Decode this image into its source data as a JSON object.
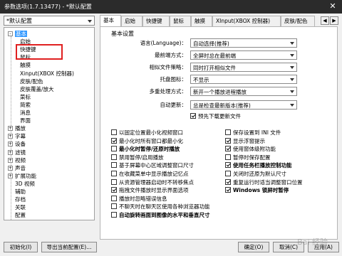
{
  "window": {
    "title": "参数选项(1.7.13477) - *默认配置",
    "close_glyph": "✕"
  },
  "profile": {
    "selected": "*默认配置"
  },
  "tree": {
    "items": [
      {
        "label": "基本",
        "expander": "-",
        "selected": true
      },
      {
        "label": "启始"
      },
      {
        "label": "快捷键"
      },
      {
        "label": "鼠标"
      },
      {
        "label": "触摸"
      },
      {
        "label": "Xinput(XBOX 控制器)"
      },
      {
        "label": "皮肤/配色"
      },
      {
        "label": "皮肤覆盖/放大"
      },
      {
        "label": "菜标"
      },
      {
        "label": "简索"
      },
      {
        "label": "消息"
      },
      {
        "label": "界面"
      },
      {
        "label": "播放",
        "expander": "+"
      },
      {
        "label": "字幕",
        "expander": "+"
      },
      {
        "label": "设备",
        "expander": "+"
      },
      {
        "label": "滤镜",
        "expander": "+"
      },
      {
        "label": "视频",
        "expander": "+"
      },
      {
        "label": "声音",
        "expander": "+"
      },
      {
        "label": "扩展功能",
        "expander": "+"
      },
      {
        "label": "3D 视频"
      },
      {
        "label": "辅助"
      },
      {
        "label": "存档"
      },
      {
        "label": "关联"
      },
      {
        "label": "配置"
      }
    ]
  },
  "tabs": [
    "基本",
    "启始",
    "快捷键",
    "鼠标",
    "触摸",
    "XInput(XBOX 控制器)",
    "皮肤/配色"
  ],
  "tab_scroll": {
    "left": "◀",
    "right": "▶"
  },
  "settings": {
    "group_title": "基本设置",
    "rows": [
      {
        "label": "语言(Language)：",
        "value": "自动选择(推荐)"
      },
      {
        "label": "最前端方式：",
        "value": "全屏时总在最前端"
      },
      {
        "label": "相似文件策略：",
        "value": "同时打开相似文件"
      },
      {
        "label": "托盘图标：",
        "value": "不显示"
      },
      {
        "label": "多重处理方式：",
        "value": "新开一个播放进程播放"
      },
      {
        "label": "自动更新：",
        "value": "总是检查最新版本(推荐)"
      }
    ],
    "prerelease": {
      "label": "预先下载更新文件",
      "checked": true
    }
  },
  "options_left": [
    {
      "label": "以固定位置最小化视频窗口",
      "checked": false
    },
    {
      "label": "最小化时所有窗口都最小化",
      "checked": true
    },
    {
      "label": "最小化时暂停/还原时播放",
      "checked": false,
      "bold": true
    },
    {
      "label": "禁用暂停/启用播放",
      "checked": false
    },
    {
      "label": "基于屏幕中心区域调整窗口尺寸",
      "checked": false
    },
    {
      "label": "在收藏菜单中显示播放记忆点",
      "checked": false
    },
    {
      "label": "从资源管理器启动时不转移焦点",
      "checked": false
    },
    {
      "label": "拖拽文件播放时显示界面选项",
      "checked": true
    },
    {
      "label": "播放时忽略错误信息",
      "checked": false
    },
    {
      "label": "不聊天时在聊天区使用各种浏览器功能",
      "checked": false
    },
    {
      "label": "自动旋转画面到图像的水平和垂直尺寸",
      "checked": false,
      "bold": true
    }
  ],
  "options_right": [
    {
      "label": "保存设置到 INI 文件",
      "checked": false
    },
    {
      "label": "显示浮窗提示",
      "checked": true
    },
    {
      "label": "使用窗体级附功能",
      "checked": true
    },
    {
      "label": "暂停时保存配置",
      "checked": false
    },
    {
      "label": "使用任务栏播放控制功能",
      "checked": true,
      "bold": true
    },
    {
      "label": "关闭时还原为默认尺寸",
      "checked": false
    },
    {
      "label": "重复运行时适当调整窗口位置",
      "checked": true
    },
    {
      "label": "Windows 锁屏时暂停",
      "checked": true,
      "bold": true
    }
  ],
  "buttons": {
    "init": "初始化(I)",
    "export": "导出当前配置(E)...",
    "ok": "确定(O)",
    "cancel": "取消(C)",
    "apply": "应用(A)"
  },
  "watermark": "Bai 经验"
}
